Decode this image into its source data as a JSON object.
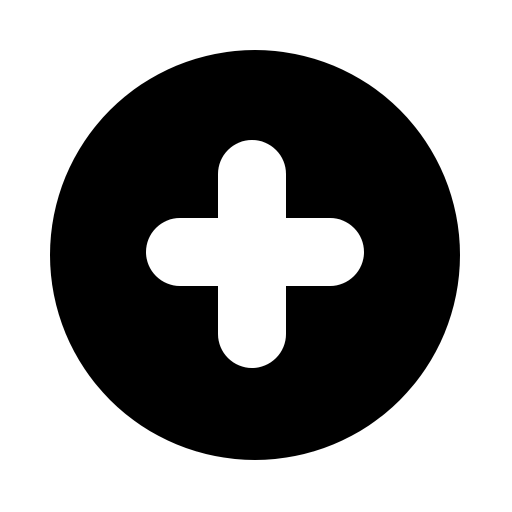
{
  "icon": {
    "name": "add-circle-icon",
    "glyph": "plus",
    "background_color": "#ffffff",
    "circle_color": "#000000",
    "plus_color": "#ffffff"
  }
}
